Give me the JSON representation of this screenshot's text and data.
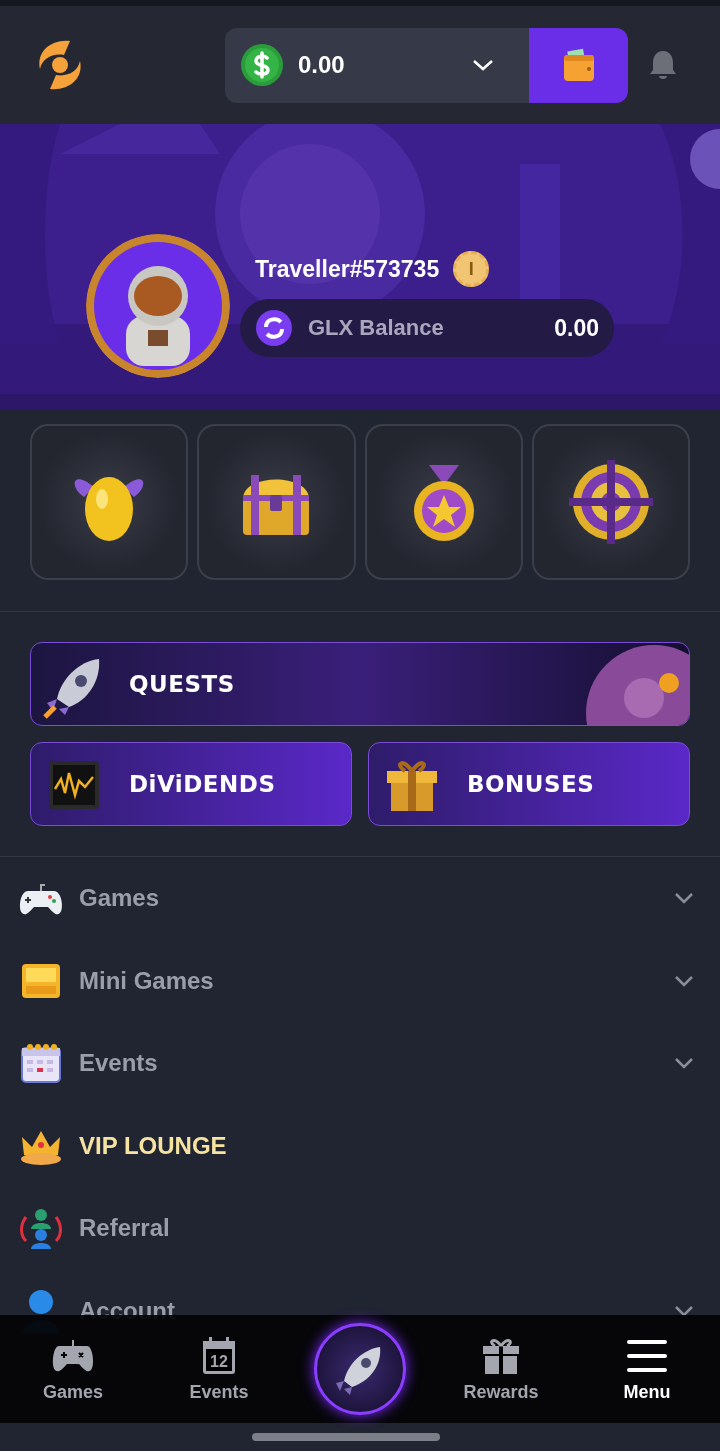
{
  "header": {
    "balance": "0.00"
  },
  "profile": {
    "username": "Traveller#573735",
    "level_badge": "I",
    "glx_label": "GLX Balance",
    "glx_value": "0.00"
  },
  "reward_tiles": [
    {
      "kind": "egg"
    },
    {
      "kind": "chest"
    },
    {
      "kind": "medal"
    },
    {
      "kind": "wheel"
    }
  ],
  "promo_banners": [
    {
      "label": "QUESTS",
      "kind": "quests"
    },
    {
      "label": "DiViDENDS",
      "kind": "dividends"
    },
    {
      "label": "BONUSES",
      "kind": "bonuses"
    }
  ],
  "menu": [
    {
      "label": "Games",
      "kind": "gamepad",
      "expandable": true,
      "highlighted": false
    },
    {
      "label": "Mini Games",
      "kind": "minigames",
      "expandable": true,
      "highlighted": false
    },
    {
      "label": "Events",
      "kind": "calendar",
      "expandable": true,
      "highlighted": false
    },
    {
      "label": "VIP LOUNGE",
      "kind": "crown",
      "expandable": false,
      "highlighted": true
    },
    {
      "label": "Referral",
      "kind": "referral",
      "expandable": false,
      "highlighted": false
    },
    {
      "label": "Account",
      "kind": "account",
      "expandable": true,
      "highlighted": false
    }
  ],
  "bottom_nav": [
    {
      "label": "Games",
      "kind": "gamepad",
      "selected": false
    },
    {
      "label": "Events",
      "kind": "calendar",
      "date": "12",
      "selected": false
    },
    {
      "kind": "rocket",
      "selected": false
    },
    {
      "label": "Rewards",
      "kind": "gift",
      "selected": false
    },
    {
      "label": "Menu",
      "kind": "menu",
      "selected": true
    }
  ]
}
